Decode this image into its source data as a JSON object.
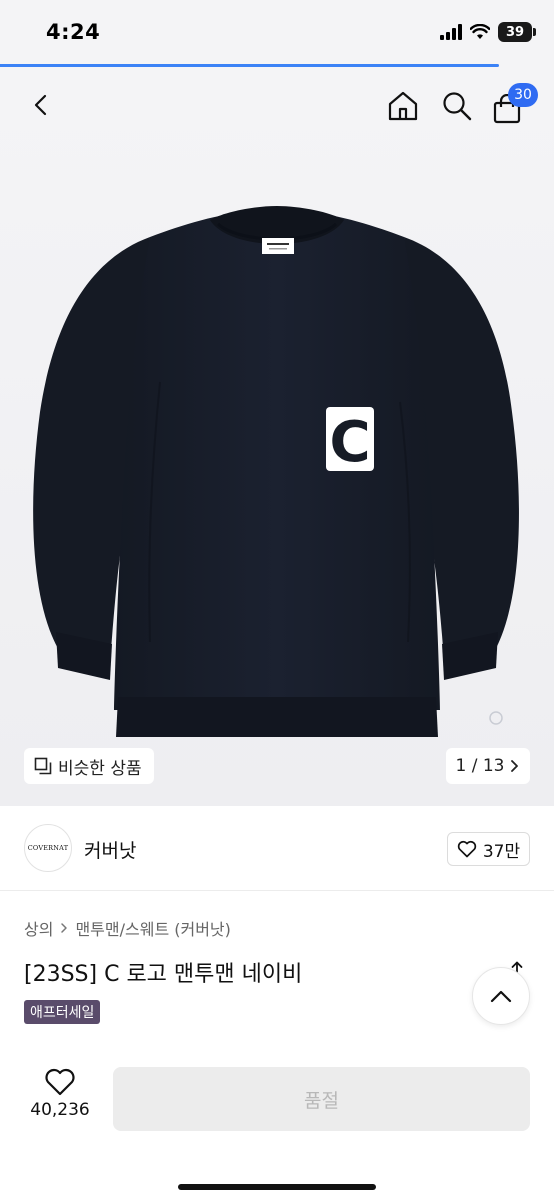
{
  "status_bar": {
    "time": "4:24",
    "battery": "39",
    "icons": [
      "signal-icon",
      "wifi-icon",
      "battery-icon"
    ]
  },
  "loading": {
    "progress": 0.9,
    "color": "#3b82f6"
  },
  "header": {
    "icons": [
      "back-icon",
      "home-icon",
      "search-icon",
      "cart-icon"
    ],
    "cart_count": "30",
    "badge_color": "#2f6bf2"
  },
  "gallery": {
    "similar_label": "비슷한 상품",
    "current": "1",
    "total": "13",
    "page_label": "1 / 13",
    "product_colors": {
      "body": "#171c26",
      "logo_patch": "#ffffff"
    },
    "logo_letter": "C"
  },
  "brand": {
    "name": "커버낫",
    "logo_text": "COVERNAT",
    "likes": "37만"
  },
  "product": {
    "breadcrumb": [
      "상의",
      "맨투맨/스웨트 (커버낫)"
    ],
    "title": "[23SS] C 로고 맨투맨 네이비",
    "badge": "애프터세일",
    "badge_color": "#5a4c6b"
  },
  "bottom_bar": {
    "wish_count": "40,236",
    "buy_label": "품절"
  }
}
